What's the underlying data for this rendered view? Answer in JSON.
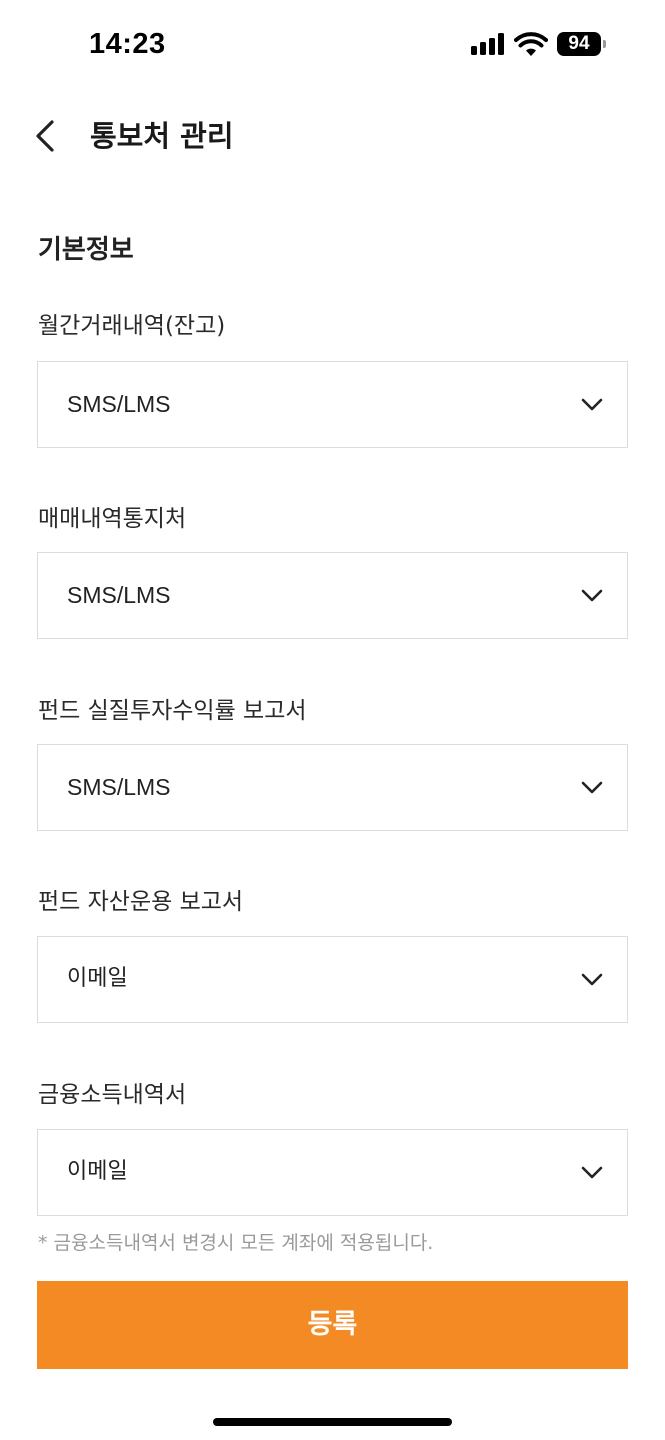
{
  "status_bar": {
    "time": "14:23",
    "battery": "94",
    "icons": [
      "signal-icon",
      "wifi-icon",
      "battery-icon"
    ]
  },
  "header": {
    "title": "통보처 관리",
    "back_icon": "chevron-left-icon"
  },
  "section": {
    "title": "기본정보"
  },
  "fields": [
    {
      "label": "월간거래내역(잔고)",
      "value": "SMS/LMS"
    },
    {
      "label": "매매내역통지처",
      "value": "SMS/LMS"
    },
    {
      "label": "펀드 실질투자수익률 보고서",
      "value": "SMS/LMS"
    },
    {
      "label": "펀드 자산운용 보고서",
      "value": "이메일"
    },
    {
      "label": "금융소득내역서",
      "value": "이메일"
    }
  ],
  "footnote": "* 금융소득내역서  변경시 모든 계좌에 적용됩니다.",
  "submit_button": {
    "label": "등록",
    "color": "#f38a23"
  }
}
